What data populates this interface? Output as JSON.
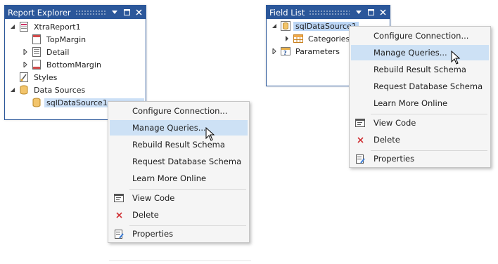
{
  "report_explorer": {
    "title": "Report Explorer",
    "nodes": {
      "root": "XtraReport1",
      "top_margin": "TopMargin",
      "detail": "Detail",
      "bottom_margin": "BottomMargin",
      "styles": "Styles",
      "data_sources": "Data Sources",
      "sql_data_source": "sqlDataSource1"
    }
  },
  "field_list": {
    "title": "Field List",
    "nodes": {
      "sql_data_source": "sqlDataSource1",
      "categories": "Categories",
      "parameters": "Parameters"
    }
  },
  "context_menu": {
    "configure_connection": "Configure Connection...",
    "manage_queries": "Manage Queries...",
    "rebuild_result_schema": "Rebuild Result Schema",
    "request_database_schema": "Request Database Schema",
    "learn_more_online": "Learn More Online",
    "view_code": "View Code",
    "delete": "Delete",
    "properties": "Properties"
  },
  "colors": {
    "title_bar": "#2b579a",
    "selection": "#cce0f7",
    "menu_hover": "#cde1f5",
    "delete_icon": "#d13438"
  }
}
